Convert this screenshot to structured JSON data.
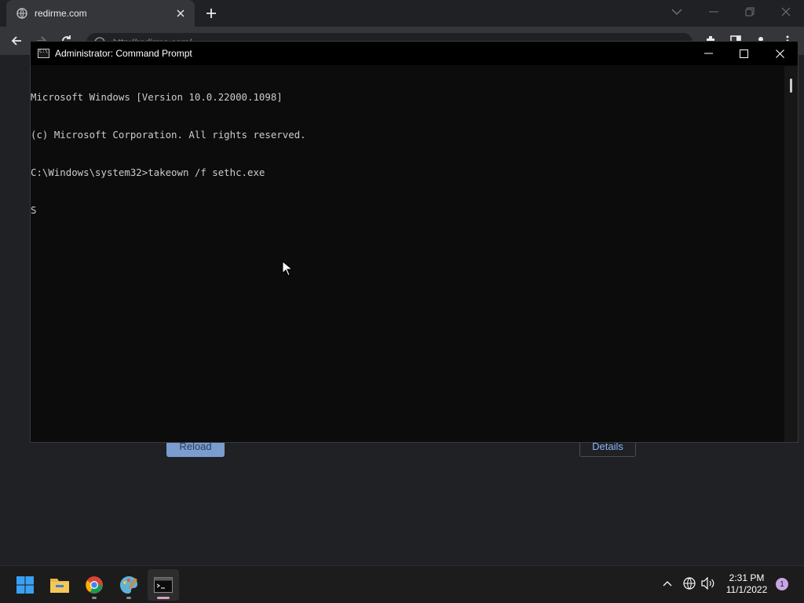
{
  "browser": {
    "tab_title": "redirme.com",
    "url": "http://redirme.com/",
    "reload_label": "Reload",
    "details_label": "Details"
  },
  "cmd": {
    "title": "Administrator: Command Prompt",
    "lines": [
      "Microsoft Windows [Version 10.0.22000.1098]",
      "(c) Microsoft Corporation. All rights reserved.",
      "C:\\Windows\\system32>takeown /f sethc.exe",
      "S"
    ]
  },
  "taskbar": {
    "time": "2:31 PM",
    "date": "11/1/2022",
    "notification_count": "1"
  },
  "colors": {
    "console_bg": "#0c0c0c",
    "console_text": "#cccccc",
    "taskbar_bg": "#1c1c1c",
    "browser_bg": "#202124"
  },
  "icons": {
    "tab": "globe-icon",
    "start": "windows-start-icon",
    "explorer": "folder-icon",
    "chrome": "chrome-icon",
    "paint": "paint-icon",
    "terminal": "command-prompt-icon"
  }
}
